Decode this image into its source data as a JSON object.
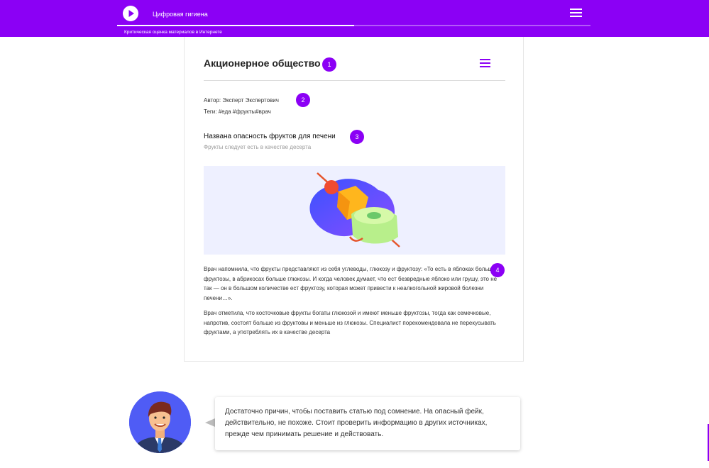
{
  "header": {
    "app_title": "Цифровая гигиена",
    "subtitle": "Критическая оценка материалов в Интернете",
    "progress": 0.5
  },
  "icons": {
    "play": "play-icon",
    "menu": "hamburger-menu-icon",
    "avatar": "expert-avatar"
  },
  "colors": {
    "accent": "#8b00f5",
    "illustration_bg": "#eef0ff"
  },
  "article": {
    "title": "Акционерное общество",
    "author": "Автор: Эксперт Экспертович",
    "tags": "Теги: #еда #фрукты#врач",
    "headline": "Названа опасность фруктов для печени",
    "lead": "Фрукты следует есть в качестве десерта",
    "paragraphs": [
      "Врач напомнила, что фрукты представляют из себя углеводы, глюкозу и фруктозу: «То есть в яблоках больше фруктозы, в абрикосах больше глюкозы. И когда человек думает, что ест безвредные яблоко или грушу, это не так — он в большом количестве ест фруктозу, которая может привести к неалкогольной жировой болезни печени…».",
      "Врач отметила, что косточковые фрукты богаты глюкозой и имеют меньше фруктозы, тогда как семечковые, напротив, состоят больше из фруктовы и меньше из глюкозы. Специалист порекомендовала не перекусывать фруктами, а употреблять их в качестве десерта"
    ]
  },
  "badges": [
    "1",
    "2",
    "3",
    "4"
  ],
  "expert": {
    "message": "Достаточно причин, чтобы поставить статью под сомнение. На опасный фейк, действительно, не похоже. Стоит проверить информацию в других источниках, прежде чем принимать решение и действовать."
  }
}
